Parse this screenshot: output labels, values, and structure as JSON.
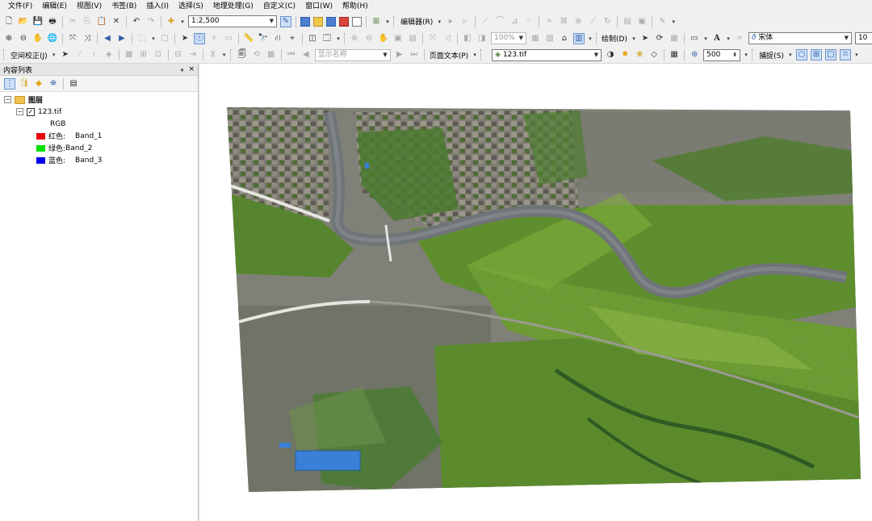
{
  "menu": [
    "文件(F)",
    "编辑(E)",
    "视图(V)",
    "书签(B)",
    "插入(I)",
    "选择(S)",
    "地理处理(G)",
    "自定义(C)",
    "窗口(W)",
    "帮助(H)"
  ],
  "toolbar1": {
    "scale_value": "1:2,500",
    "editor_label": "编辑器(R)"
  },
  "toolbar2": {
    "zoom_percent": "100%",
    "draw_label": "绘制(D)",
    "text_tool_label": "A",
    "font_name": "宋体",
    "font_size": "10",
    "bold_label": "B",
    "italic_label": "I",
    "underline_label": "U"
  },
  "toolbar3": {
    "spatial_adjust_label": "空间校正(J)",
    "display_name_placeholder": "显示名称",
    "page_text_label": "页面文本(P)",
    "layer_select": "123.tif",
    "resolution_value": "500",
    "snap_label": "捕捉(S)"
  },
  "toc": {
    "title": "内容列表",
    "pin_label": "ᵩ",
    "close_label": "×",
    "layers_group": "图层",
    "layer_name": "123.tif",
    "rgb_label": "RGB",
    "bands": [
      {
        "label": "红色:",
        "band": "Band_1",
        "color": "#e8000b"
      },
      {
        "label": "绿色:",
        "band": "Band_2",
        "color": "#00e000"
      },
      {
        "label": "蓝色:",
        "band": "Band_3",
        "color": "#0000ee"
      }
    ]
  },
  "colors": {
    "vegetation_dark": "#3d6a2a",
    "vegetation_light": "#7fae3c",
    "river": "#6f7478",
    "bare_ground": "#8c8c82",
    "roof_blue": "#3a7fd8"
  }
}
